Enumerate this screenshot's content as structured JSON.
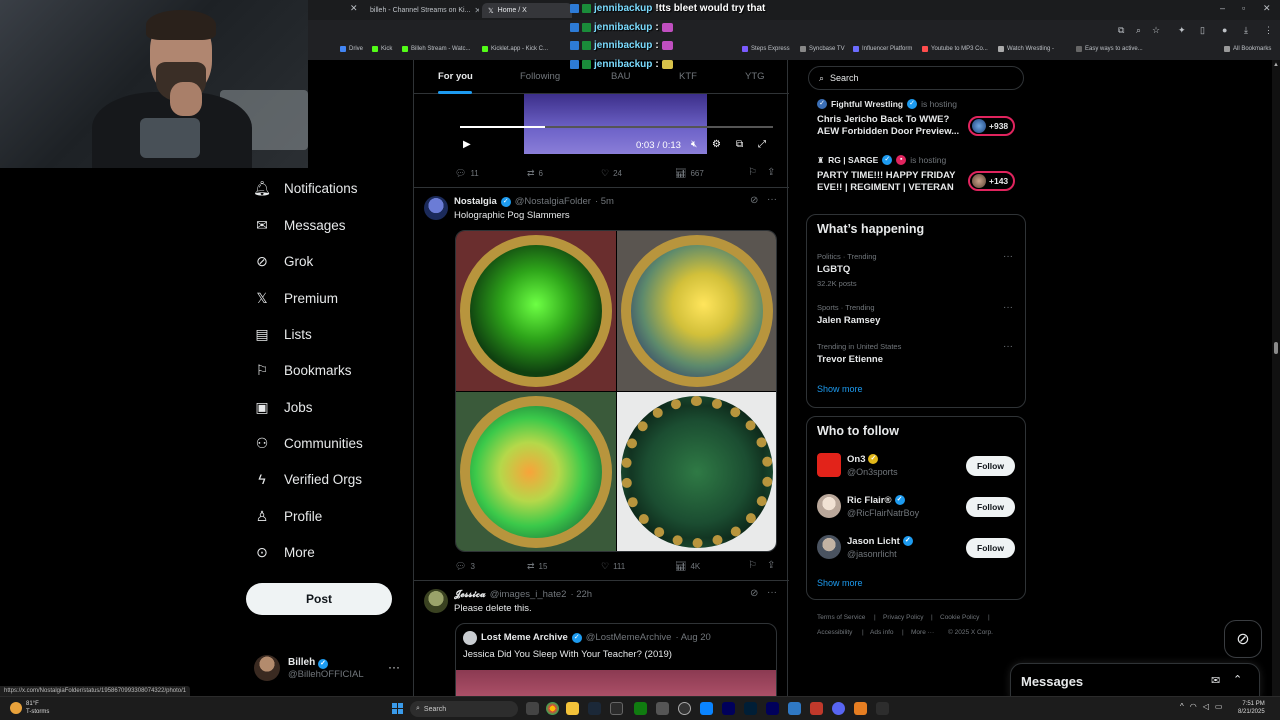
{
  "browser": {
    "tabs": [
      {
        "label": "billeh - Channel Streams on Ki..."
      },
      {
        "label": "Home / X"
      }
    ],
    "bookmarks": [
      "Drive",
      "Kick",
      "Billeh Stream - Watc...",
      "Kicklet.app - Kick C...",
      "Steps Express",
      "Syncbase TV",
      "Influencer Platform",
      "Youtube to MP3 Co...",
      "Watch Wrestling -",
      "Easy ways to active...",
      "All Bookmarks"
    ],
    "status_url": "https://x.com/NostalgiaFolder/status/1958670993308074322/photo/1"
  },
  "chat": [
    {
      "user": "jennibackup",
      "message": "!tts bleet would try that"
    },
    {
      "user": "jennibackup",
      "message": ":"
    },
    {
      "user": "jennibackup",
      "message": ":"
    },
    {
      "user": "jennibackup",
      "message": ":"
    }
  ],
  "nav": {
    "items": [
      {
        "label": "Notifications",
        "icon": "bell-icon",
        "glyph": "🔔︎"
      },
      {
        "label": "Messages",
        "icon": "mail-icon",
        "glyph": "✉"
      },
      {
        "label": "Grok",
        "icon": "grok-icon",
        "glyph": "⊘"
      },
      {
        "label": "Premium",
        "icon": "x-logo-icon",
        "glyph": "𝕏"
      },
      {
        "label": "Lists",
        "icon": "list-icon",
        "glyph": "▤"
      },
      {
        "label": "Bookmarks",
        "icon": "bookmark-icon",
        "glyph": "⚐"
      },
      {
        "label": "Jobs",
        "icon": "briefcase-icon",
        "glyph": "▣"
      },
      {
        "label": "Communities",
        "icon": "people-icon",
        "glyph": "⚇"
      },
      {
        "label": "Verified Orgs",
        "icon": "lightning-icon",
        "glyph": "ϟ"
      },
      {
        "label": "Profile",
        "icon": "person-icon",
        "glyph": "♙"
      },
      {
        "label": "More",
        "icon": "more-circle-icon",
        "glyph": "⊙"
      }
    ],
    "post_label": "Post",
    "account": {
      "name": "Billeh",
      "handle": "@BillehOFFICIAL"
    }
  },
  "timeline": {
    "tabs": [
      "For you",
      "Following",
      "BAU",
      "KTF",
      "YTG"
    ],
    "video": {
      "time": "0:03 / 0:13",
      "progress": 0.27
    },
    "prev_actions": {
      "replies": "11",
      "reposts": "6",
      "likes": "24",
      "views": "667"
    },
    "tweet1": {
      "name": "Nostalgia",
      "handle": "@NostalgiaFolder",
      "time": "· 5m",
      "text": "Holographic Pog Slammers",
      "actions": {
        "replies": "3",
        "reposts": "15",
        "likes": "111",
        "views": "4K"
      }
    },
    "tweet2": {
      "name": "𝓙𝓮𝓼𝓼𝓲𝓬𝓪",
      "handle": "@images_i_hate2",
      "time": "· 22h",
      "text": "Please delete this.",
      "quote": {
        "name": "Lost Meme Archive",
        "handle": "@LostMemeArchive",
        "time": "· Aug 20",
        "text": "Jessica Did You Sleep With Your Teacher? (2019)"
      }
    }
  },
  "right": {
    "search_placeholder": "Search",
    "hosting": [
      {
        "source": "Fightful Wrestling",
        "is_hosting": "is hosting",
        "title": "Chris Jericho Back To WWE? AEW Forbidden Door Preview...",
        "count": "+938"
      },
      {
        "source": "RG | SARGE",
        "is_hosting": "is hosting",
        "title": "PARTY TIME!!! HAPPY FRIDAY EVE!! | REGIMENT | VETERAN",
        "count": "+143"
      }
    ],
    "whats_happening": {
      "title": "What’s happening",
      "trends": [
        {
          "category": "Politics · Trending",
          "title": "LGBTQ",
          "count": "32.2K posts"
        },
        {
          "category": "Sports · Trending",
          "title": "Jalen Ramsey",
          "count": ""
        },
        {
          "category": "Trending in United States",
          "title": "Trevor Etienne",
          "count": ""
        }
      ],
      "show_more": "Show more"
    },
    "who_to_follow": {
      "title": "Who to follow",
      "accounts": [
        {
          "name": "On3",
          "handle": "@On3sports",
          "follow": "Follow"
        },
        {
          "name": "Ric Flair®",
          "handle": "@RicFlairNatrBoy",
          "follow": "Follow"
        },
        {
          "name": "Jason Licht",
          "handle": "@jasonrlicht",
          "follow": "Follow"
        }
      ],
      "show_more": "Show more"
    },
    "footer": [
      "Terms of Service",
      "|",
      "Privacy Policy",
      "|",
      "Cookie Policy",
      "|",
      "Accessibility",
      "|",
      "Ads info",
      "|",
      "More ···",
      "© 2025 X Corp."
    ]
  },
  "messages_drawer": {
    "title": "Messages"
  },
  "taskbar": {
    "weather": {
      "temp": "81°F",
      "desc": "T-storms"
    },
    "search": "Search",
    "time": "7:51 PM",
    "date": "8/21/2025"
  },
  "colors": {
    "accent": "#1d9bf0",
    "live": "#e0245e",
    "background": "#000000"
  }
}
